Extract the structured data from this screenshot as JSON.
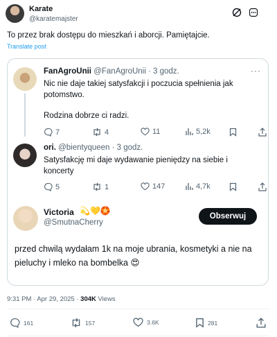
{
  "tweet": {
    "author_name": "Karate",
    "author_handle": "@karatemajster",
    "text": "To przez brak dostępu do mieszkań i aborcji. Pamiętajcie.",
    "translate": "Translate post",
    "timestamp": "9:31 PM · Apr 29, 2025 · ",
    "views_count": "304K",
    "views_label": " Views",
    "stats": {
      "replies": "161",
      "reposts": "157",
      "likes": "3.6K",
      "bookmarks": "281"
    }
  },
  "quoted": {
    "replies": [
      {
        "name": "FanAgroUnii",
        "meta": "@FanAgroUnii · 3 godz.",
        "text_line1": "Nic nie daje takiej satysfakcji i poczucia spełnienia jak potomstwo.",
        "text_line2": "Rodzina dobrze ci radzi.",
        "stats": {
          "replies": "7",
          "reposts": "4",
          "likes": "11",
          "views": "5,2k"
        }
      },
      {
        "name": "ori.",
        "meta": "@bientyqueen · 3 godz.",
        "text_line1": "Satysfakcję mi daje wydawanie pieniędzy na siebie i koncerty",
        "stats": {
          "replies": "5",
          "reposts": "1",
          "likes": "147",
          "views": "4,7k"
        }
      }
    ],
    "victoria": {
      "name": "Victoria",
      "emoji": "💫💛🏵️",
      "handle": "@SmutnaCherry",
      "follow_label": "Obserwuj",
      "text": "przed chwilą wydałam 1k na moje ubrania, kosmetyki a nie na pieluchy i mleko na bombelka 😍"
    }
  },
  "colors": {
    "link": "#1d9bf0",
    "muted": "#536471",
    "text": "#0f1419",
    "border": "#cfd9de"
  }
}
